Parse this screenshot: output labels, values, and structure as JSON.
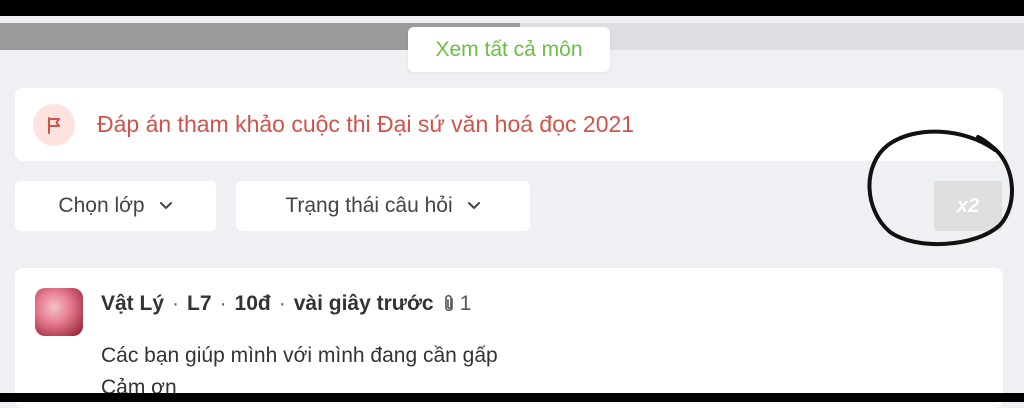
{
  "header": {
    "see_all_label": "Xem tất cả môn"
  },
  "banner": {
    "icon": "flag-icon",
    "text": "Đáp án tham khảo cuộc thi Đại sứ văn hoá đọc 2021",
    "color": "#d0534a"
  },
  "filters": {
    "class_label": "Chọn lớp",
    "status_label": "Trạng thái câu hỏi"
  },
  "badge": {
    "label": "x2"
  },
  "question": {
    "subject": "Vật Lý",
    "grade": "L7",
    "points": "10đ",
    "time": "vài giây trước",
    "attachment_count": "1",
    "line1": "Các bạn giúp mình với mình đang cần gấp",
    "line2": "Cảm ơn"
  },
  "colors": {
    "accent_green": "#6cbf3f",
    "accent_red": "#d0534a"
  }
}
